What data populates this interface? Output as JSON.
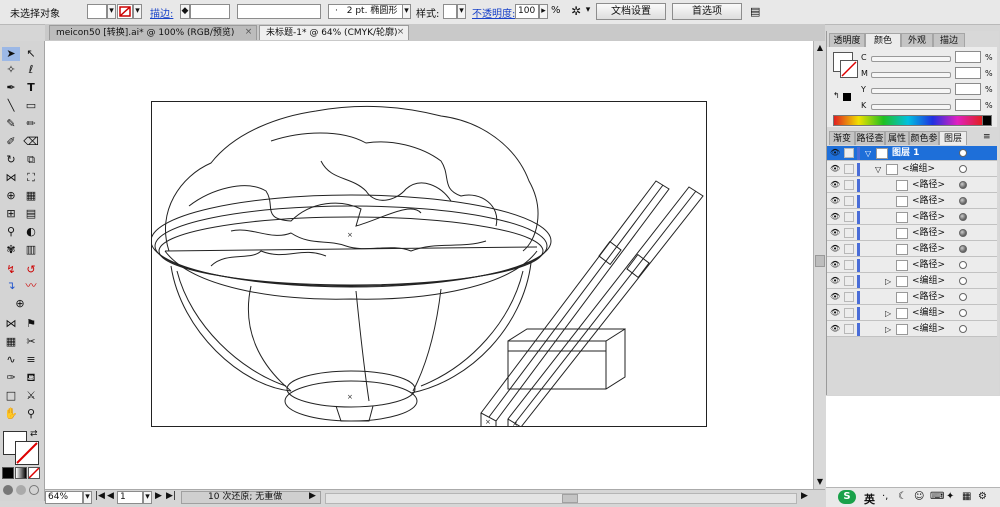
{
  "control_bar": {
    "selection": "未选择对象",
    "stroke_link": "描边:",
    "stroke_weight": "",
    "brush_value": "2 pt.",
    "brush_name": "椭圆形",
    "style_label": "样式:",
    "opacity_link": "不透明度:",
    "opacity_value": "100",
    "opacity_unit": "%",
    "doc_setup_button": "文档设置",
    "prefs_button": "首选项"
  },
  "tabs": [
    {
      "label": "meicon50 [转换].ai* @ 100% (RGB/预览)",
      "close": "×"
    },
    {
      "label": "未标题-1* @ 64% (CMYK/轮廓)",
      "close": "×"
    }
  ],
  "status_bar": {
    "zoom": "64%",
    "page": "1",
    "history": "10 次还原; 无重做"
  },
  "color_panel": {
    "tabs": [
      "透明度",
      "颜色",
      "外观",
      "描边"
    ],
    "active_tab": "颜色",
    "channels": [
      "C",
      "M",
      "Y",
      "K"
    ],
    "percent": "%"
  },
  "layers_panel": {
    "tabs": [
      "渐变",
      "路径查",
      "属性",
      "颜色参",
      "图层"
    ],
    "active_tab": "图层",
    "rows": [
      {
        "name": "图层 1",
        "indent": 0,
        "arrow": "▽",
        "selected": true,
        "target_filled": false
      },
      {
        "name": "<编组>",
        "indent": 1,
        "arrow": "▽",
        "selected": false,
        "target_filled": false
      },
      {
        "name": "<路径>",
        "indent": 2,
        "arrow": "",
        "selected": false,
        "target_filled": true
      },
      {
        "name": "<路径>",
        "indent": 2,
        "arrow": "",
        "selected": false,
        "target_filled": true
      },
      {
        "name": "<路径>",
        "indent": 2,
        "arrow": "",
        "selected": false,
        "target_filled": true
      },
      {
        "name": "<路径>",
        "indent": 2,
        "arrow": "",
        "selected": false,
        "target_filled": true
      },
      {
        "name": "<路径>",
        "indent": 2,
        "arrow": "",
        "selected": false,
        "target_filled": true
      },
      {
        "name": "<路径>",
        "indent": 2,
        "arrow": "",
        "selected": false,
        "target_filled": false
      },
      {
        "name": "<编组>",
        "indent": 2,
        "arrow": "▷",
        "selected": false,
        "target_filled": false
      },
      {
        "name": "<路径>",
        "indent": 2,
        "arrow": "",
        "selected": false,
        "target_filled": false
      },
      {
        "name": "<编组>",
        "indent": 2,
        "arrow": "▷",
        "selected": false,
        "target_filled": false
      },
      {
        "name": "<编组>",
        "indent": 2,
        "arrow": "▷",
        "selected": false,
        "target_filled": false
      }
    ]
  },
  "taskbar": {
    "ime": "英"
  },
  "colors": {
    "accent": "#1e6fd9",
    "layer_color": "#4a6dd8",
    "link": "#1a43c9"
  }
}
